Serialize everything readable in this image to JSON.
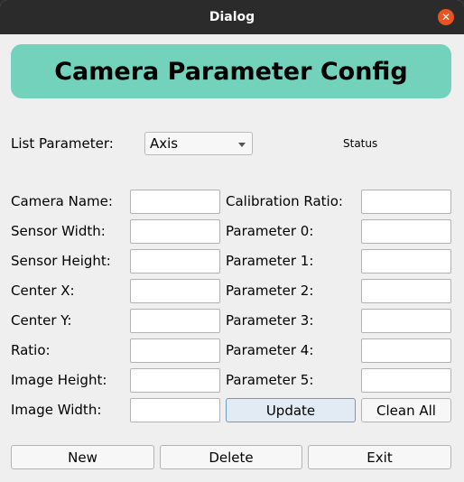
{
  "window": {
    "title": "Dialog"
  },
  "banner": {
    "text": "Camera Parameter Config"
  },
  "list_parameter": {
    "label": "List Parameter:",
    "selected": "Axis"
  },
  "status": {
    "text": "Status"
  },
  "left_fields": [
    {
      "label": "Camera Name:",
      "value": ""
    },
    {
      "label": "Sensor Width:",
      "value": ""
    },
    {
      "label": "Sensor Height:",
      "value": ""
    },
    {
      "label": "Center X:",
      "value": ""
    },
    {
      "label": "Center Y:",
      "value": ""
    },
    {
      "label": "Ratio:",
      "value": ""
    },
    {
      "label": "Image Height:",
      "value": ""
    },
    {
      "label": "Image Width:",
      "value": ""
    }
  ],
  "right_fields": [
    {
      "label": "Calibration Ratio:",
      "value": ""
    },
    {
      "label": "Parameter 0:",
      "value": ""
    },
    {
      "label": "Parameter 1:",
      "value": ""
    },
    {
      "label": "Parameter 2:",
      "value": ""
    },
    {
      "label": "Parameter 3:",
      "value": ""
    },
    {
      "label": "Parameter 4:",
      "value": ""
    },
    {
      "label": "Parameter 5:",
      "value": ""
    }
  ],
  "buttons": {
    "update": "Update",
    "clean_all": "Clean All",
    "new": "New",
    "delete": "Delete",
    "exit": "Exit"
  },
  "colors": {
    "banner": "#73d2bc",
    "titlebar": "#2b2b2b",
    "close": "#e95420",
    "focus": "#6f9ac6"
  }
}
